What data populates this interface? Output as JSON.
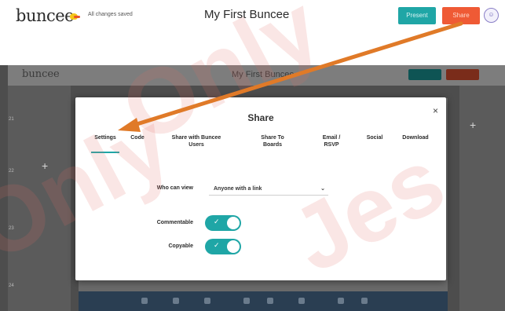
{
  "topbar": {
    "logo": "buncee",
    "save_status": "All changes saved",
    "title": "My First Buncee",
    "present_label": "Present",
    "share_label": "Share",
    "avatar_icon": "user-icon"
  },
  "inner": {
    "logo": "buncee",
    "title": "My First Buncee",
    "row_numbers": [
      "21",
      "22",
      "23",
      "24"
    ]
  },
  "dialog": {
    "title": "Share",
    "close": "×",
    "tabs": [
      {
        "label": "Settings",
        "active": true
      },
      {
        "label": "Code"
      },
      {
        "label": "Share with Buncee Users"
      },
      {
        "label": "Share To Boards"
      },
      {
        "label": "Email / RSVP"
      },
      {
        "label": "Social"
      },
      {
        "label": "Download"
      }
    ],
    "who_can_view_label": "Who can view",
    "who_can_view_value": "Anyone with a link",
    "commentable_label": "Commentable",
    "commentable_on": true,
    "copyable_label": "Copyable",
    "copyable_on": true
  },
  "watermark": [
    "Only",
    "Only",
    "Jes"
  ],
  "colors": {
    "accent_teal": "#1fa6a6",
    "share_orange": "#ef5a35",
    "arrow": "#e07a28"
  }
}
